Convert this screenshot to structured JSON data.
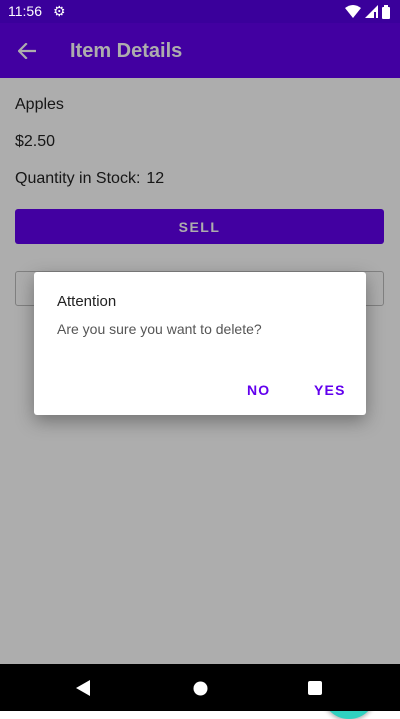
{
  "status_bar": {
    "time": "11:56",
    "icons": [
      "settings-icon",
      "wifi-icon",
      "signal-icon",
      "battery-icon"
    ]
  },
  "app_bar": {
    "title": "Item Details",
    "back_icon": "arrow-back-icon",
    "color": "#6200ee"
  },
  "item": {
    "name": "Apples",
    "price": "$2.50",
    "quantity_label": "Quantity in Stock:",
    "quantity_value": "12"
  },
  "buttons": {
    "sell_label": "SELL"
  },
  "fab": {
    "icon": "edit-pencil-icon",
    "color": "#2fd1c0"
  },
  "dialog": {
    "title": "Attention",
    "message": "Are you sure you want to delete?",
    "negative_label": "NO",
    "positive_label": "YES"
  },
  "nav_bar": {
    "icons": [
      "nav-back-icon",
      "nav-home-icon",
      "nav-recents-icon"
    ]
  }
}
